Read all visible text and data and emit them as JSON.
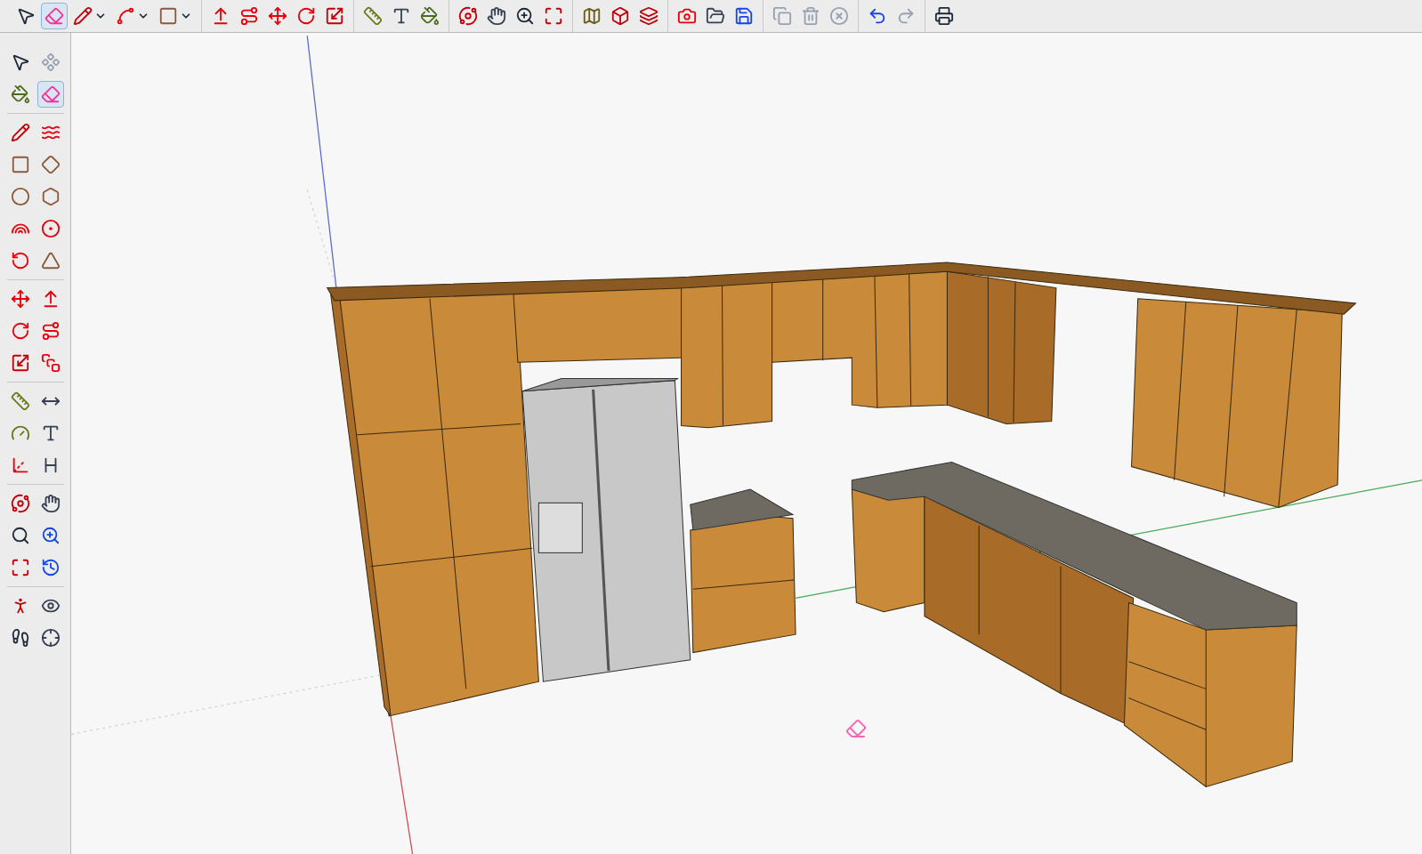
{
  "top_toolbar": {
    "groups": [
      {
        "tools": [
          {
            "selected": false,
            "menu": false
          },
          {
            "selected": true,
            "menu": false
          },
          {
            "selected": false,
            "menu": true
          },
          {
            "selected": false,
            "menu": true
          },
          {
            "selected": false,
            "menu": true
          }
        ]
      },
      {
        "tools": [
          {
            "selected": false,
            "menu": false
          },
          {
            "selected": false,
            "menu": false
          },
          {
            "selected": false,
            "menu": false
          },
          {
            "selected": false,
            "menu": false
          },
          {
            "selected": false,
            "menu": false
          }
        ]
      },
      {
        "tools": [
          {
            "selected": false,
            "menu": false
          },
          {
            "selected": false,
            "menu": false
          },
          {
            "selected": false,
            "menu": false
          }
        ]
      },
      {
        "tools": [
          {
            "selected": false,
            "menu": false
          },
          {
            "selected": false,
            "menu": false
          },
          {
            "selected": false,
            "menu": false
          },
          {
            "selected": false,
            "menu": false
          }
        ]
      },
      {
        "tools": [
          {
            "selected": false,
            "menu": false
          },
          {
            "selected": false,
            "menu": false
          },
          {
            "selected": false,
            "menu": false
          }
        ]
      },
      {
        "tools": [
          {
            "selected": false,
            "menu": false
          },
          {
            "selected": false,
            "menu": false
          },
          {
            "selected": false,
            "menu": false
          }
        ]
      },
      {
        "tools": [
          {
            "selected": false,
            "menu": false
          },
          {
            "selected": false,
            "menu": false
          },
          {
            "selected": false,
            "menu": false
          }
        ]
      },
      {
        "tools": [
          {
            "selected": false,
            "menu": false
          },
          {
            "selected": false,
            "menu": false
          }
        ]
      },
      {
        "tools": [
          {
            "selected": false,
            "menu": false
          }
        ]
      }
    ]
  },
  "left_toolbar": {
    "groups": [
      {
        "tools": [
          {
            "selected": false
          },
          {
            "selected": false
          },
          {
            "selected": false
          },
          {
            "selected": true
          }
        ]
      },
      {
        "tools": [
          {
            "selected": false
          },
          {
            "selected": false
          },
          {
            "selected": false
          },
          {
            "selected": false
          },
          {
            "selected": false
          },
          {
            "selected": false
          },
          {
            "selected": false
          },
          {
            "selected": false
          },
          {
            "selected": false
          },
          {
            "selected": false
          }
        ]
      },
      {
        "tools": [
          {
            "selected": false
          },
          {
            "selected": false
          },
          {
            "selected": false
          },
          {
            "selected": false
          },
          {
            "selected": false
          },
          {
            "selected": false
          }
        ]
      },
      {
        "tools": [
          {
            "selected": false
          },
          {
            "selected": false
          },
          {
            "selected": false
          },
          {
            "selected": false
          },
          {
            "selected": false
          },
          {
            "selected": false
          }
        ]
      },
      {
        "tools": [
          {
            "selected": false
          },
          {
            "selected": false
          },
          {
            "selected": false
          },
          {
            "selected": false
          },
          {
            "selected": false
          },
          {
            "selected": false
          }
        ]
      },
      {
        "tools": [
          {
            "selected": false
          },
          {
            "selected": false
          },
          {
            "selected": false
          },
          {
            "selected": false
          }
        ]
      }
    ]
  }
}
